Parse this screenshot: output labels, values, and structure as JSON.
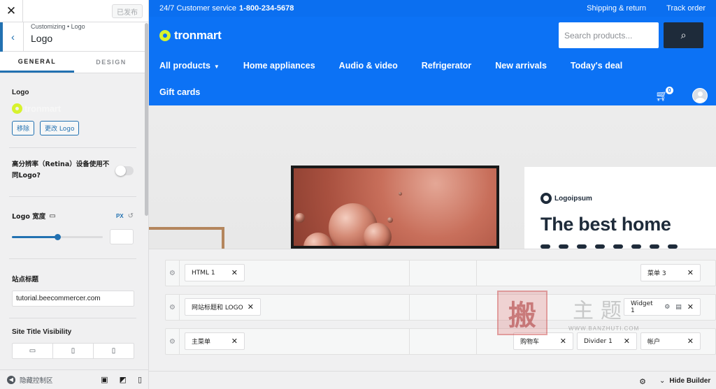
{
  "sidebar": {
    "close_icon": "close-icon",
    "publish_label": "已发布",
    "section_crumb": "Customizing • Logo",
    "section_title": "Logo",
    "tabs": [
      {
        "label": "GENERAL",
        "active": true
      },
      {
        "label": "DESIGN",
        "active": false
      }
    ],
    "logo_label": "Logo",
    "logo_preview_text": "tronmart",
    "remove_label": "移除",
    "change_label": "更改 Logo",
    "retina_label": "高分辨率（Retina）设备使用不同Logo?",
    "retina_enabled": false,
    "width_label": "Logo 宽度",
    "width_unit": "PX",
    "width_slider_fraction": 0.5,
    "site_title_label": "站点标题",
    "site_title_value": "tutorial.beecommercer.com",
    "visibility_label": "Site Title Visibility",
    "hide_controls_label": "隐藏控制区"
  },
  "preview": {
    "accent": "#0c72f5",
    "topbar": {
      "service_text": "24/7 Customer service",
      "phone": "1-800-234-5678",
      "links": [
        "Shipping & return",
        "Track order"
      ]
    },
    "brand": "tronmart",
    "search_placeholder": "Search products...",
    "nav": [
      "All products",
      "Home appliances",
      "Audio & video",
      "Refrigerator",
      "New arrivals",
      "Today's deal"
    ],
    "nav_second_row": "Gift cards",
    "cart_count": "0",
    "promo": {
      "logo_text": "Logoipsum",
      "headline": "The best home"
    }
  },
  "builder": {
    "rows": [
      {
        "left": [
          "HTML 1"
        ],
        "right": [
          "菜单 3"
        ]
      },
      {
        "left": [
          "网站标题和 LOGO"
        ],
        "right": [
          "Widget 1"
        ]
      },
      {
        "left": [
          "主菜单"
        ],
        "right": [
          "购物车",
          "Divider 1",
          "帐户"
        ]
      }
    ],
    "hide_builder_label": "Hide Builder"
  },
  "watermark": {
    "seal_char": "搬",
    "chars": "主题",
    "url": "WWW.BANZHUTI.COM"
  }
}
